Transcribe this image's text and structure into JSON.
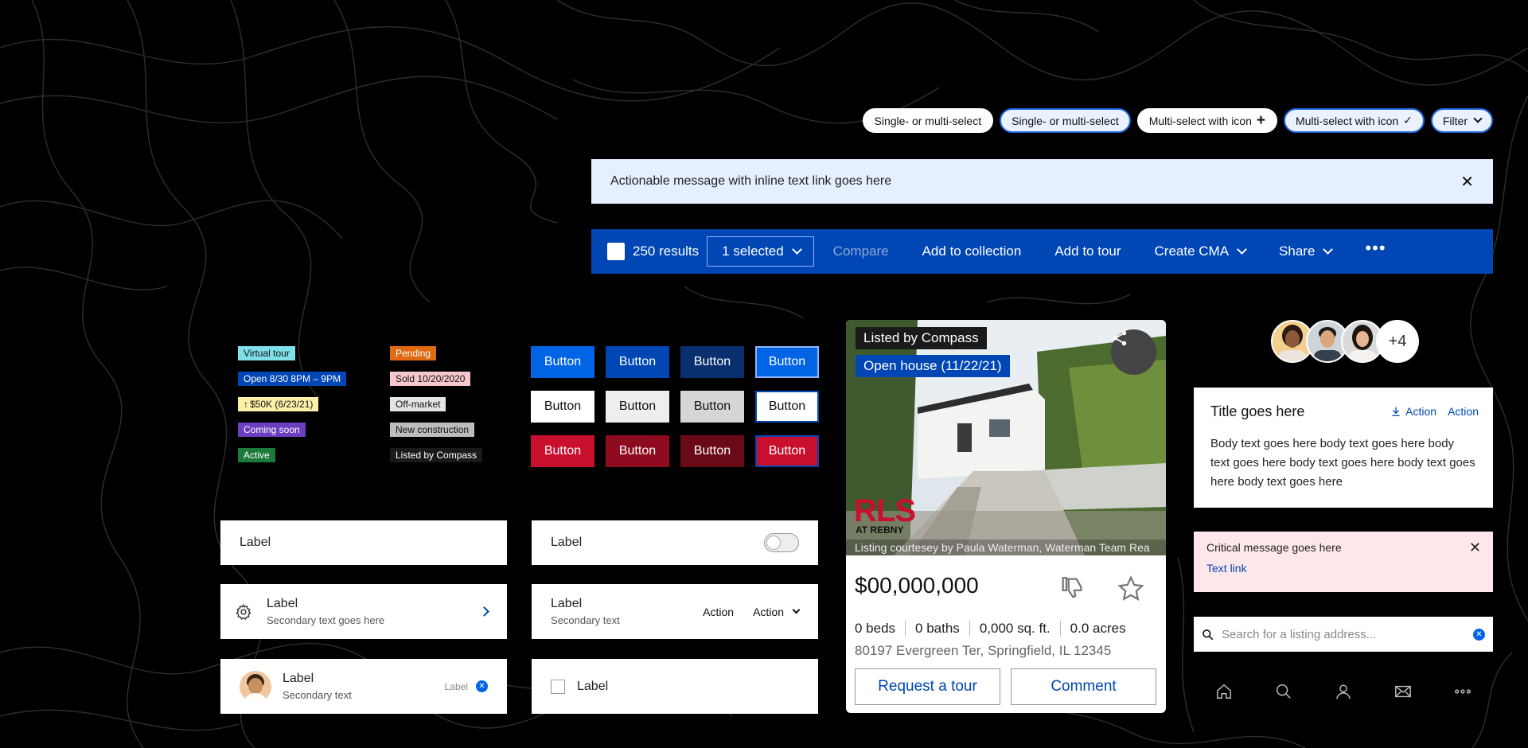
{
  "chips": [
    {
      "label": "Single- or multi-select",
      "selected": false,
      "icon": ""
    },
    {
      "label": "Single- or multi-select",
      "selected": true,
      "icon": ""
    },
    {
      "label": "Multi-select with icon",
      "selected": false,
      "icon": "plus-icon"
    },
    {
      "label": "Multi-select with icon",
      "selected": true,
      "icon": "check-icon"
    },
    {
      "label": "Filter",
      "selected": true,
      "icon": "chevron-down-icon"
    }
  ],
  "banner": {
    "message": "Actionable message with inline text link goes here",
    "close_icon": "close-icon"
  },
  "bulkbar": {
    "results": "250 results",
    "selected": "1 selected",
    "compare": "Compare",
    "add_collection": "Add to collection",
    "add_tour": "Add to tour",
    "create_cma": "Create CMA",
    "share": "Share",
    "more_icon": "more-horizontal-icon"
  },
  "tags": {
    "left": [
      {
        "label": "Virtual tour",
        "bg": "#7fe0ea",
        "fg": "#111"
      },
      {
        "label": "Open 8/30 8PM – 9PM",
        "bg": "#0046b4",
        "fg": "#fff"
      },
      {
        "label": "$50K (6/23/21)",
        "bg": "#fdf0a8",
        "fg": "#111"
      },
      {
        "label": "Coming soon",
        "bg": "#6b3fbf",
        "fg": "#fff"
      },
      {
        "label": "Active",
        "bg": "#1e7a3a",
        "fg": "#fff"
      }
    ],
    "right": [
      {
        "label": "Pending",
        "bg": "#e06a12",
        "fg": "#fff"
      },
      {
        "label": "Sold 10/20/2020",
        "bg": "#f6c7cc",
        "fg": "#111"
      },
      {
        "label": "Off-market",
        "bg": "#e4e4e4",
        "fg": "#111"
      },
      {
        "label": "New construction",
        "bg": "#bdbdbd",
        "fg": "#111"
      },
      {
        "label": "Listed by Compass",
        "bg": "#1a1a1a",
        "fg": "#fff"
      }
    ]
  },
  "buttons": {
    "label": "Button",
    "rows": [
      [
        {
          "bg": "#0064e5",
          "fg": "#fff",
          "bd": "#0064e5"
        },
        {
          "bg": "#0046b4",
          "fg": "#fff",
          "bd": "#0046b4"
        },
        {
          "bg": "#0a2f6e",
          "fg": "#fff",
          "bd": "#0a2f6e"
        },
        {
          "bg": "#0064e5",
          "fg": "#fff",
          "bd": "#8fb4ff"
        }
      ],
      [
        {
          "bg": "#fff",
          "fg": "#111",
          "bd": "#fff"
        },
        {
          "bg": "#eeeeee",
          "fg": "#111",
          "bd": "#eeeeee"
        },
        {
          "bg": "#d6d6d6",
          "fg": "#111",
          "bd": "#d6d6d6"
        },
        {
          "bg": "#fff",
          "fg": "#111",
          "bd": "#0046b4"
        }
      ],
      [
        {
          "bg": "#c8102e",
          "fg": "#fff",
          "bd": "#c8102e"
        },
        {
          "bg": "#8e0b1f",
          "fg": "#fff",
          "bd": "#8e0b1f"
        },
        {
          "bg": "#6a0a18",
          "fg": "#fff",
          "bd": "#6a0a18"
        },
        {
          "bg": "#c8102e",
          "fg": "#fff",
          "bd": "#0046b4"
        }
      ]
    ]
  },
  "forms": {
    "text_label": "Label",
    "toggle_label": "Label",
    "nav_label": "Label",
    "nav_secondary": "Secondary text goes here",
    "action_label": "Label",
    "action_secondary": "Secondary text",
    "action1": "Action",
    "action2": "Action",
    "avatar_label": "Label",
    "avatar_secondary": "Secondary text",
    "avatar_tag": "Label",
    "checkbox_label": "Label"
  },
  "listing": {
    "listed_by": "Listed by Compass",
    "open_house": "Open house (11/22/21)",
    "brand": "RLS",
    "brand_sub": "AT REBNY",
    "courtesy": "Listing courtesey by Paula Waterman, Waterman Team Rea",
    "price": "$00,000,000",
    "beds": "0 beds",
    "baths": "0 baths",
    "sqft": "0,000 sq. ft.",
    "acres": "0.0 acres",
    "address": "80197 Evergreen Ter, Springfield, IL 12345",
    "tour_btn": "Request a tour",
    "comment_btn": "Comment"
  },
  "avatars": {
    "more": "+4"
  },
  "infocard": {
    "title": "Title goes here",
    "action1": "Action",
    "action2": "Action",
    "body": "Body text goes here body text goes here body text goes here body text goes here body text goes here body text goes here"
  },
  "critical": {
    "message": "Critical message goes here",
    "link": "Text link"
  },
  "search": {
    "placeholder": "Search for a listing address..."
  },
  "tabbar": [
    "home-icon",
    "search-icon",
    "person-icon",
    "mail-icon",
    "more-horizontal-icon"
  ]
}
